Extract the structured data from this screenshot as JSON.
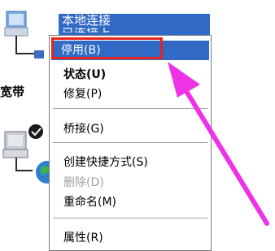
{
  "connection_item": {
    "line1": "本地连接",
    "line2": "已连接上"
  },
  "side_label": "宽带",
  "context_menu": {
    "items": [
      {
        "label": "停用(B)",
        "state": "selected"
      },
      {
        "label": "状态(U)",
        "state": "default"
      },
      {
        "label": "修复(P)",
        "state": "normal"
      },
      {
        "label": "桥接(G)",
        "state": "normal"
      },
      {
        "label": "创建快捷方式(S)",
        "state": "normal"
      },
      {
        "label": "删除(D)",
        "state": "disabled"
      },
      {
        "label": "重命名(M)",
        "state": "normal"
      },
      {
        "label": "属性(R)",
        "state": "normal"
      }
    ]
  },
  "colors": {
    "selection": "#316ac5",
    "highlight_box": "#e8231c",
    "annotation_arrow": "#ee33e6"
  },
  "icons": [
    "network-computer-icon",
    "broadband-connection-icon"
  ]
}
